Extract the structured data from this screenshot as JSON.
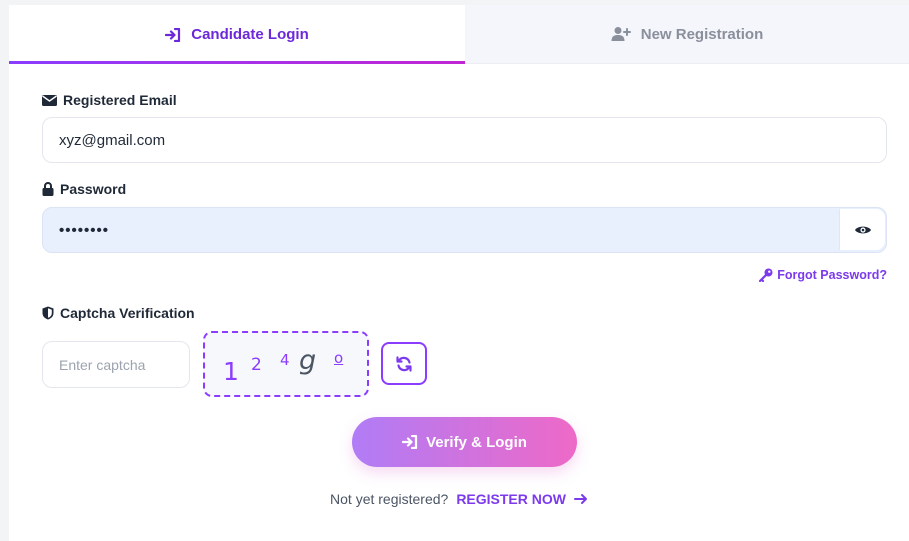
{
  "tabs": {
    "login_label": "Candidate Login",
    "register_label": "New Registration"
  },
  "form": {
    "email": {
      "label": "Registered Email",
      "value": "xyz@gmail.com",
      "icon": "envelope-icon"
    },
    "password": {
      "label": "Password",
      "value": "••••••••",
      "icon": "lock-icon"
    },
    "forgot_label": "Forgot Password?",
    "captcha": {
      "label": "Captcha Verification",
      "placeholder": "Enter captcha",
      "chars": [
        "1",
        "2",
        "4",
        "g",
        "o"
      ]
    },
    "submit_label": "Verify & Login"
  },
  "footer": {
    "prompt": "Not yet registered?",
    "link_label": "REGISTER NOW"
  },
  "colors": {
    "accent": "#7c3aed",
    "gradient_start": "#b07cf6",
    "gradient_end": "#ee69c7"
  }
}
